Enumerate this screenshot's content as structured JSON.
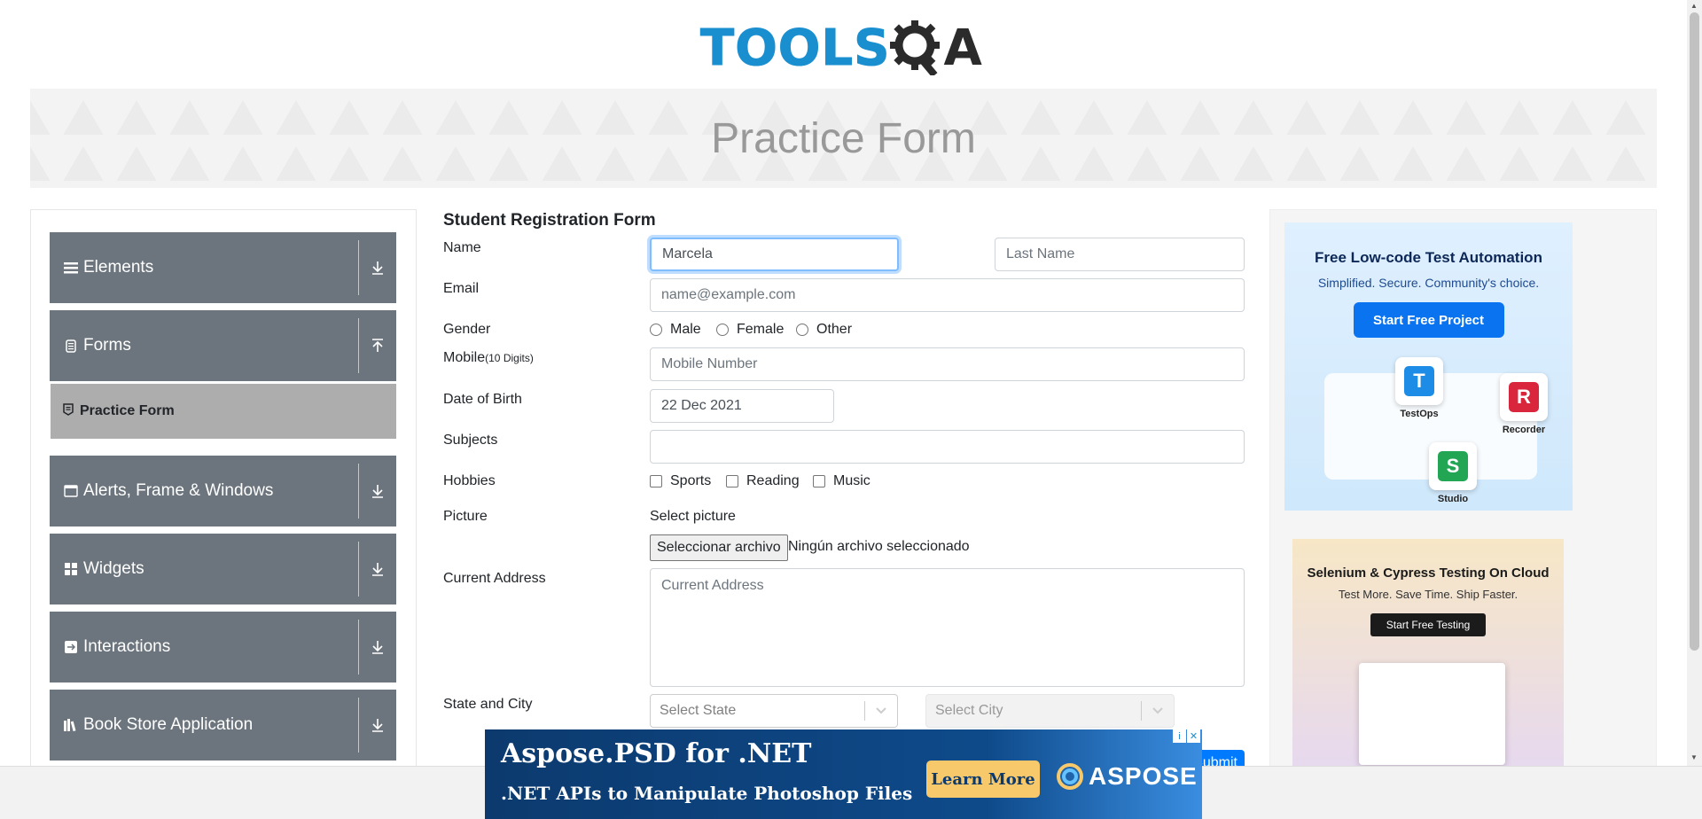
{
  "logo": {
    "text_left": "TOOLS",
    "text_right": "A"
  },
  "banner": {
    "title": "Practice Form"
  },
  "sidebar": {
    "groups": [
      {
        "label": "Elements",
        "icon": "list-icon",
        "arrow": "download-arrow-icon"
      },
      {
        "label": "Forms",
        "icon": "document-icon",
        "arrow": "upload-arrow-icon"
      },
      {
        "label": "Alerts, Frame & Windows",
        "icon": "window-icon",
        "arrow": "download-arrow-icon"
      },
      {
        "label": "Widgets",
        "icon": "grid-icon",
        "arrow": "download-arrow-icon"
      },
      {
        "label": "Interactions",
        "icon": "interaction-icon",
        "arrow": "download-arrow-icon"
      },
      {
        "label": "Book Store Application",
        "icon": "books-icon",
        "arrow": "download-arrow-icon"
      }
    ],
    "active_item": {
      "label": "Practice Form",
      "icon": "form-icon"
    }
  },
  "form": {
    "title": "Student Registration Form",
    "name_label": "Name",
    "first_name_value": "Marcela",
    "last_name_placeholder": "Last Name",
    "email_label": "Email",
    "email_placeholder": "name@example.com",
    "gender_label": "Gender",
    "genders": [
      "Male",
      "Female",
      "Other"
    ],
    "mobile_label": "Mobile",
    "mobile_hint": "(10 Digits)",
    "mobile_placeholder": "Mobile Number",
    "dob_label": "Date of Birth",
    "dob_value": "22 Dec 2021",
    "subjects_label": "Subjects",
    "hobbies_label": "Hobbies",
    "hobbies": [
      "Sports",
      "Reading",
      "Music"
    ],
    "picture_label": "Picture",
    "select_picture": "Select picture",
    "file_button": "Seleccionar archivo",
    "file_status": "Ningún archivo seleccionado",
    "address_label": "Current Address",
    "address_placeholder": "Current Address",
    "state_city_label": "State and City",
    "state_placeholder": "Select State",
    "city_placeholder": "Select City",
    "submit_label": "Submit"
  },
  "ads": {
    "ad1": {
      "headline": "Free Low-code Test Automation",
      "subline": "Simplified. Secure. Community's choice.",
      "button": "Start Free Project",
      "tiles": [
        "TestOps",
        "Recorder",
        "Studio"
      ]
    },
    "ad2": {
      "headline": "Selenium & Cypress Testing On Cloud",
      "subline": "Test More. Save Time. Ship Faster.",
      "button": "Start Free Testing"
    },
    "bottom": {
      "title": "Aspose.PSD for .NET",
      "subtitle": ".NET APIs to Manipulate Photoshop Files",
      "button": "Learn More",
      "brand": "ASPOSE",
      "info": "i",
      "close": "✕"
    }
  },
  "colors": {
    "sidebar_group": "#6c757d",
    "active_item": "#adadad",
    "primary": "#007bff",
    "logo_blue": "#1a8fd0"
  }
}
